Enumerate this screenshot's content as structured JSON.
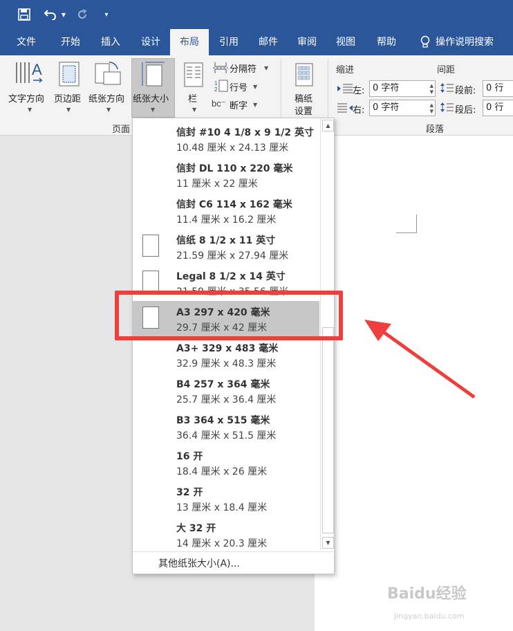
{
  "quick_access": {
    "save_icon": "save-icon",
    "undo_icon": "undo-icon",
    "redo_icon": "redo-icon",
    "customize_icon": "customize-qat-icon"
  },
  "tabs": [
    {
      "label": "文件"
    },
    {
      "label": "开始"
    },
    {
      "label": "插入"
    },
    {
      "label": "设计"
    },
    {
      "label": "布局"
    },
    {
      "label": "引用"
    },
    {
      "label": "邮件"
    },
    {
      "label": "审阅"
    },
    {
      "label": "视图"
    },
    {
      "label": "帮助"
    }
  ],
  "tell_me": {
    "label": "操作说明搜索",
    "icon": "lightbulb-icon"
  },
  "ribbon": {
    "text_direction": "文字方向",
    "margins": "页边距",
    "orientation": "纸张方向",
    "size": "纸张大小",
    "columns": "栏",
    "breaks": "分隔符",
    "line_numbers": "行号",
    "hyphenation": "断字",
    "draft_line1": "稿纸",
    "draft_line2": "设置",
    "page_setup_group": "页面",
    "indent_header": "缩进",
    "spacing_header": "间距",
    "indent_left_label": "左:",
    "indent_left_value": "0 字符",
    "indent_right_label": "右:",
    "indent_right_value": "0 字符",
    "spacing_before_label": "段前:",
    "spacing_before_value": "0 行",
    "spacing_after_label": "段后:",
    "spacing_after_value": "0 行",
    "paragraph_group": "段落"
  },
  "paper_sizes": [
    {
      "name": "信封 #10 4 1/8 x 9 1/2 英寸",
      "dims": "10.48 厘米 x 24.13 厘米",
      "icon": false
    },
    {
      "name": "信封 DL 110 x 220 毫米",
      "dims": "11 厘米 x 22 厘米",
      "icon": false
    },
    {
      "name": "信封 C6 114 x 162 毫米",
      "dims": "11.4 厘米 x 16.2 厘米",
      "icon": false
    },
    {
      "name": "信纸 8 1/2 x 11 英寸",
      "dims": "21.59 厘米 x 27.94 厘米",
      "icon": true
    },
    {
      "name": "Legal 8 1/2 x 14 英寸",
      "dims": "21.59 厘米 x 35.56 厘米",
      "icon": true
    },
    {
      "name": "A3 297 x 420 毫米",
      "dims": "29.7 厘米 x 42 厘米",
      "icon": true,
      "selected": true
    },
    {
      "name": "A3+ 329 x 483 毫米",
      "dims": "32.9 厘米 x 48.3 厘米",
      "icon": false
    },
    {
      "name": "B4 257 x 364 毫米",
      "dims": "25.7 厘米 x 36.4 厘米",
      "icon": false
    },
    {
      "name": "B3 364 x 515 毫米",
      "dims": "36.4 厘米 x 51.5 厘米",
      "icon": false
    },
    {
      "name": "16 开",
      "dims": "18.4 厘米 x 26 厘米",
      "icon": false
    },
    {
      "name": "32 开",
      "dims": "13 厘米 x 18.4 厘米",
      "icon": false
    },
    {
      "name": "大 32 开",
      "dims": "14 厘米 x 20.3 厘米",
      "icon": false
    }
  ],
  "more_sizes": "其他纸张大小(A)...",
  "annotation": {
    "box_color": "#ee3f3f",
    "arrow_color": "#ee3f3f"
  },
  "watermark": {
    "main": "Baidu经验",
    "sub": "jingyan.baidu.com"
  },
  "colors": {
    "title_bar": "#2b579a",
    "ribbon": "#f3f3f3",
    "highlight": "#c7c7c7"
  }
}
